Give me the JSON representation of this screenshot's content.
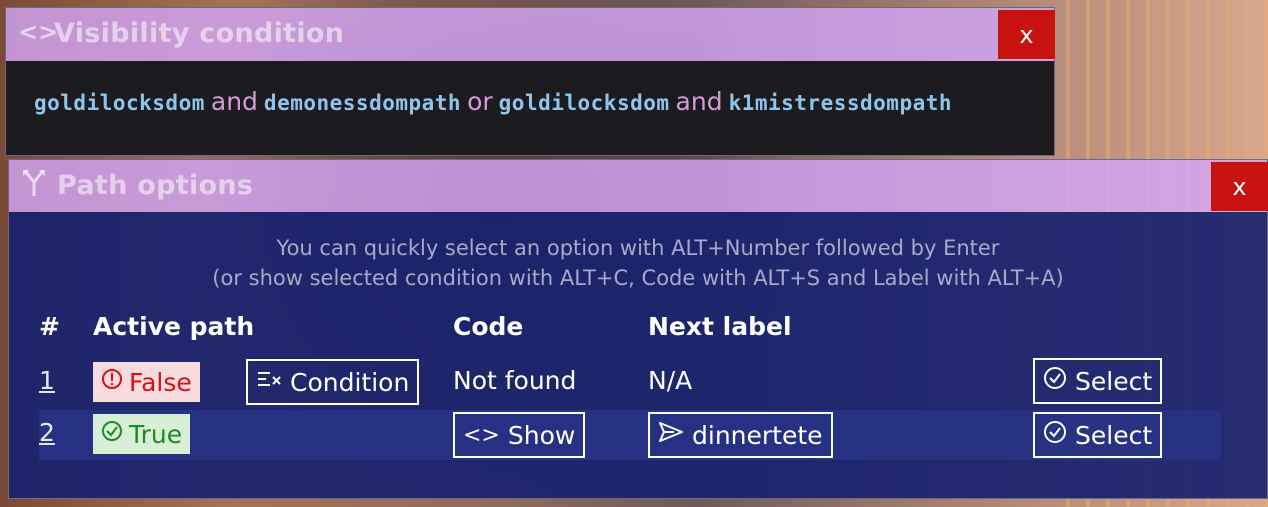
{
  "visibility_window": {
    "title": "Visibility condition",
    "title_icon": "code-icon",
    "close_label": "x",
    "condition": {
      "var1": "goldilocksdom",
      "op1": "and",
      "var2": "demonessdompath",
      "op2": "or",
      "var3": "goldilocksdom",
      "op3": "and",
      "var4": "k1mistressdompath"
    }
  },
  "path_window": {
    "title": "Path options",
    "title_icon": "fork-icon",
    "close_label": "x",
    "hint_line1": "You can quickly select an option with ALT+Number followed by Enter",
    "hint_line2": "(or show selected condition with ALT+C, Code with ALT+S and Label with ALT+A)",
    "columns": {
      "num": "#",
      "active": "Active path",
      "code": "Code",
      "next": "Next label"
    },
    "rows": [
      {
        "num": "1",
        "status": "False",
        "status_icon": "alert-circle-icon",
        "condition_button": "Condition",
        "code": "Not found",
        "next_label": "N/A",
        "select_label": "Select"
      },
      {
        "num": "2",
        "status": "True",
        "status_icon": "check-circle-icon",
        "code_button": "Show",
        "next_button": "dinnertete",
        "select_label": "Select"
      }
    ]
  },
  "colors": {
    "titlebar": "#d2a5f5",
    "close": "#c8120f",
    "panel_blue": "#18226e",
    "condition_var": "#8fc4ec",
    "condition_op": "#d79ad9"
  }
}
